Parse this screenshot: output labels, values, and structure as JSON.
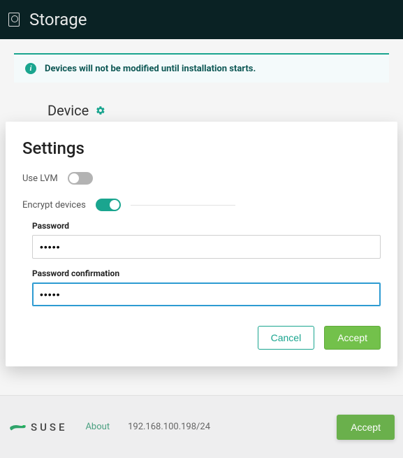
{
  "header": {
    "title": "Storage"
  },
  "info_banner": {
    "text": "Devices will not be modified until installation starts."
  },
  "device_section": {
    "label": "Device"
  },
  "modal": {
    "title": "Settings",
    "use_lvm_label": "Use LVM",
    "use_lvm_on": false,
    "encrypt_label": "Encrypt devices",
    "encrypt_on": true,
    "password_label": "Password",
    "password_value": "•••••",
    "password_confirm_label": "Password confirmation",
    "password_confirm_value": "•••••",
    "cancel_label": "Cancel",
    "accept_label": "Accept"
  },
  "footer": {
    "brand": "SUSE",
    "about_label": "About",
    "ip": "192.168.100.198/24",
    "accept_label": "Accept"
  }
}
